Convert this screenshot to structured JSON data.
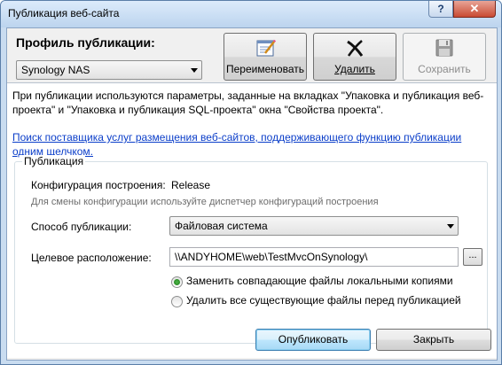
{
  "window": {
    "title": "Публикация веб-сайта",
    "help_glyph": "?",
    "close_glyph": "✕"
  },
  "profile": {
    "title": "Профиль публикации:",
    "selected": "Synology NAS",
    "buttons": {
      "rename": {
        "label": "Переименовать",
        "icon": "rename-icon"
      },
      "delete": {
        "label": "Удалить",
        "icon": "delete-icon"
      },
      "save": {
        "label": "Сохранить",
        "icon": "save-icon"
      }
    }
  },
  "info": {
    "text": "При публикации используются параметры, заданные на вкладках \"Упаковка и публикация веб-проекта\" и \"Упаковка и публикация SQL-проекта\" окна \"Свойства проекта\".",
    "link": "Поиск поставщика услуг размещения веб-сайтов, поддерживающего функцию публикации одним щелчком."
  },
  "publish": {
    "group_title": "Публикация",
    "build_config_label": "Конфигурация построения:",
    "build_config_value": "Release",
    "build_config_hint": "Для смены конфигурации используйте диспетчер конфигураций построения",
    "method_label": "Способ публикации:",
    "method_value": "Файловая система",
    "target_label": "Целевое расположение:",
    "target_value": "\\\\ANDYHOME\\web\\TestMvcOnSynology\\",
    "browse_label": "...",
    "options": [
      {
        "label": "Заменить совпадающие файлы локальными копиями",
        "selected": true
      },
      {
        "label": "Удалить все существующие файлы перед публикацией",
        "selected": false
      }
    ]
  },
  "footer": {
    "publish_label": "Опубликовать",
    "close_label": "Закрыть"
  },
  "colors": {
    "link": "#0b3ec9",
    "frame": "#c9dcf0",
    "close_button": "#c94a33"
  }
}
